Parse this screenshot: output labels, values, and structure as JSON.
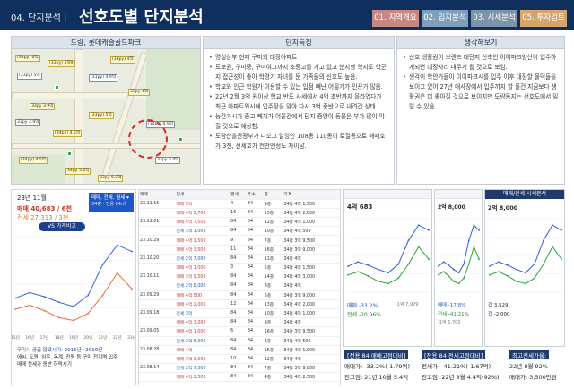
{
  "header": {
    "section": "04. 단지분석 |",
    "title": "선호도별 단지분석",
    "tabs": [
      "01. 지역개요",
      "02. 입지분석",
      "03. 시세분석",
      "05. 투자검토"
    ]
  },
  "map_panel": {
    "title": "도량, 롯데캐슬골드파크",
    "labels": [
      "(33py) 6억",
      "(33py) 5억",
      "(33py) 5억9",
      "(31py) 4.9억",
      "(33py) 4억",
      "33py 3.9억",
      "33py 2.9억",
      "(34py) 4.5억",
      "(33py) 5억",
      "(34py) 4.9억",
      "(34py) 4.5억",
      "34py 5.6억",
      "33py 3.4억",
      "33py 5.2억",
      "33py 4억"
    ]
  },
  "features_panel": {
    "title": "단지특징",
    "items": [
      "명실상부 현재 구미의 대장아파트",
      "도보권, 구미중, 구미여고까지 초중고를 거고 있고 분지형 학지도 학군지 접근성이 좋아 학령기 자녀를 둔 가족들의 신호도 높음.",
      "학교와 인근 학원가 이용할 수 있는 입점 빼닌 어필가가 인끈가 많음.",
      "22년 2월 3억 원이상 학교 반도 사세에서 4억 초반까지 올라였다가 최근 아파트와시에 입주장을 맞아 다시 3억 중반으로 내려간 상태",
      "능간가시가 종고 빼치가 어울건에서 단지 중앙이 동물은 부가 많이 막힐 것으로 예상함.",
      "도량산을관광부가 나오고 알잉인 108동 110동이 로열동으로 매매호가 3천, 전세호가 천만엔정도 차이남."
    ]
  },
  "thoughts_panel": {
    "title": "생각해보기",
    "items": [
      "신호 생활권이 브랜드 대단지 신축인 이이파크양산이 입주하게되면 대장자리 내주게 될 것으로 보임.",
      "생각이 학안가들이 이이파크시를 입주 이후 대장할 물덕들을 보이고 있어 27년 매사장에서 입주까지 할 물건 지금보다 생활권은 더 좋아질 것으로 보이지만 도량동지는 선호도에서 밀릴 수 있음."
    ]
  },
  "left_chart": {
    "period": "23년 11월",
    "sale_label": "매매 40,683 / 6천",
    "jeonse_label": "전세 27,313 / 3천",
    "legend_title": "매매, 전세, 월세 ▾",
    "legend_sub": "34평 · 전용 84㎡",
    "vs_button": "VS 가격비교",
    "note_title": "구미시 공급 많았시기: 2015년~2019년",
    "note_body": "에씨, 도원, 임우, 옥계, 진평 등 구미 전지역 입주",
    "note_body2": "매매 전세가 동반 하락시기"
  },
  "chart_data": {
    "type": "line",
    "x": [
      "15년",
      "16년",
      "17년",
      "18년",
      "19년",
      "20년",
      "21년",
      "22년",
      "23년"
    ],
    "series": [
      {
        "name": "매매",
        "values": [
          24000,
          26000,
          24500,
          22500,
          21000,
          25000,
          36000,
          43000,
          40683
        ]
      },
      {
        "name": "전세",
        "values": [
          20000,
          21500,
          19500,
          17000,
          16000,
          18500,
          25000,
          33000,
          27313
        ]
      }
    ],
    "ylim": [
      12000,
      46000
    ]
  },
  "table": {
    "headers": [
      "매매",
      "전세",
      "월세",
      "주소",
      "층",
      "평형",
      "가격"
    ],
    "rows": [
      [
        "23.11.16",
        "매매 5억",
        "4",
        "84",
        "9층",
        "34평 4억 1,500"
      ],
      [
        "",
        "매매 4억 2,700",
        "16",
        "84",
        "15층",
        "34평 4억 2,000"
      ],
      [
        "23.11.01",
        "매매 4억 7,500",
        "84",
        "84",
        "12층",
        "34평 4억 1,000"
      ],
      [
        "",
        "전세 3억 1,000",
        "84",
        "84",
        "10층",
        "34평 4억 500"
      ],
      [
        "23.10.29",
        "매매 4억 1,500",
        "9",
        "84",
        "7층",
        "34평 3억 9,500"
      ],
      [
        "",
        "매매 4억 3,500",
        "11",
        "84",
        "16층",
        "34평 3억 9,000"
      ],
      [
        "23.10.20",
        "전세 2억 7,000",
        "84",
        "84",
        "11층",
        "34평 4억"
      ],
      [
        "",
        "매매 4억 1,000",
        "3",
        "84",
        "5층",
        "34평 4억 1,500"
      ],
      [
        "23.10.11",
        "매매 3억 9,500",
        "84",
        "84",
        "14층",
        "34평 4억 3,000"
      ],
      [
        "",
        "전세 2억 8,000",
        "84",
        "84",
        "8층",
        "34평 4억"
      ],
      [
        "23.09.29",
        "매매 4억 500",
        "84",
        "84",
        "6층",
        "34평 3억 9,000"
      ],
      [
        "",
        "매매 4억 2,000",
        "12",
        "84",
        "13층",
        "34평 4억 2,000"
      ],
      [
        "23.09.18",
        "전세 3억",
        "84",
        "84",
        "10층",
        "34평 4억 1,000"
      ],
      [
        "",
        "매매 4억 3,000",
        "84",
        "84",
        "9층",
        "34평 4억"
      ],
      [
        "23.09.05",
        "매매 4억 1,000",
        "6",
        "84",
        "16층",
        "34평 3억 9,500"
      ],
      [
        "",
        "전세 2억 6,000",
        "84",
        "84",
        "3층",
        "34평 4억 500"
      ],
      [
        "23.08.28",
        "매매 4억",
        "84",
        "84",
        "15층",
        "34평 4억 1,000"
      ],
      [
        "",
        "매매 3억 9,000",
        "10",
        "84",
        "12층",
        "34평 4억"
      ],
      [
        "23.08.14",
        "전세 2억 7,500",
        "84",
        "84",
        "7층",
        "34평 3억 9,000"
      ],
      [
        "",
        "매매 4억 2,500",
        "84",
        "84",
        "4층",
        "34평 4억 2,500"
      ]
    ]
  },
  "shots": {
    "s1": {
      "price": "4억 683",
      "sale_pct": "매매 -33.2%",
      "jeonse_pct": "전세 -20.96%",
      "sub": "-1억 7,979"
    },
    "s2": {
      "price": "2억 8,000",
      "sale_pct": "매매 -17.8%",
      "jeonse_pct": "전세 -41.21%",
      "sub": "-1억 6,700"
    },
    "s3": {
      "title": "매매/전세 시세분석",
      "price": "2억 8,000",
      "a": "갭 3,529",
      "b": "갭 -2,000"
    }
  },
  "notes": {
    "n1_head": "[전용 84 매매고점대비]",
    "n1a": "매매가: -33.2%(-1.79억)",
    "n1b": "전고점: 21년 10월 5.4억",
    "n2_head": "[전용 84 전세고점대비]",
    "n2a": "전세가: -41.21%(-1.67억)",
    "n2b": "전고점: 22년 8월 4.4억(92%)",
    "n3_head": "최고전세가율:",
    "n3a": "22년 8월 92%",
    "n3b": "매매가: 3,500만원"
  }
}
